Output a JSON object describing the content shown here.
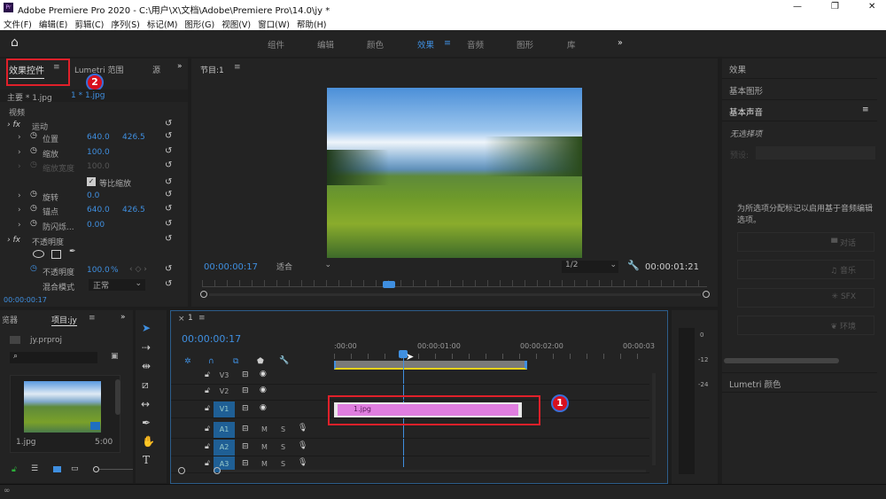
{
  "window": {
    "title": "Adobe Premiere Pro 2020 - C:\\用户\\X\\文档\\Adobe\\Premiere Pro\\14.0\\jy *",
    "app_icon": "Pr",
    "minimize": "—",
    "maximize": "❐",
    "close": "✕"
  },
  "menu": [
    "文件(F)",
    "编辑(E)",
    "剪辑(C)",
    "序列(S)",
    "标记(M)",
    "图形(G)",
    "视图(V)",
    "窗口(W)",
    "帮助(H)"
  ],
  "workspaces": {
    "items": [
      "组件",
      "编辑",
      "颜色",
      "效果",
      "音频",
      "图形",
      "库"
    ],
    "active": "效果",
    "more": "»"
  },
  "effect_controls": {
    "tabs": [
      "效果控件",
      "Lumetri 范围",
      "源"
    ],
    "more": "»",
    "source_label": "主要 * 1.jpg",
    "clip_label": "1 * 1.jpg",
    "section": "视频",
    "motion": "运动",
    "params": [
      {
        "name": "位置",
        "v1": "640.0",
        "v2": "426.5"
      },
      {
        "name": "缩放",
        "v1": "100.0"
      },
      {
        "name": "缩放宽度",
        "v1": "100.0",
        "disabled": true
      },
      {
        "name": "旋转",
        "v1": "0.0"
      },
      {
        "name": "锚点",
        "v1": "640.0",
        "v2": "426.5"
      },
      {
        "name": "防闪烁...",
        "v1": "0.00"
      }
    ],
    "uniform_scale": "等比缩放",
    "uniform_scale_checked": true,
    "opacity": "不透明度",
    "opacity_param": "不透明度",
    "opacity_value": "100.0",
    "opacity_unit": "%",
    "blend_label": "混合模式",
    "blend_value": "正常",
    "timecode": "00:00:00:17"
  },
  "program": {
    "title": "节目:1",
    "timecode": "00:00:00:17",
    "fit": "适合",
    "resolution": "1/2",
    "duration": "00:00:01:21"
  },
  "right_panel": {
    "items": [
      "效果",
      "基本图形",
      "基本声音"
    ],
    "no_selection": "无选择项",
    "preset_label": "预设:",
    "hint": "为所选项分配标记以启用基于音频编辑选项。",
    "buttons": [
      "对话",
      "音乐",
      "SFX",
      "环境"
    ],
    "lumetri": "Lumetri 颜色"
  },
  "project": {
    "tabs": [
      "览器",
      "项目:jy"
    ],
    "more": "»",
    "file": "jy.prproj",
    "clip_name": "1.jpg",
    "clip_duration": "5:00"
  },
  "timeline": {
    "tab": "1",
    "timecode": "00:00:00:17",
    "ruler": [
      ":00:00",
      "00:00:01:00",
      "00:00:02:00",
      "00:00:03"
    ],
    "video_tracks": [
      "V3",
      "V2",
      "V1"
    ],
    "audio_tracks": [
      "A1",
      "A2",
      "A3"
    ],
    "mute": "M",
    "solo": "S",
    "clip": "1.jpg"
  },
  "meter": {
    "labels": [
      "0",
      "-12",
      "-24"
    ]
  },
  "annotations": {
    "one": "1",
    "two": "2"
  },
  "colors": {
    "accent": "#3f8fe0",
    "clip": "#e07ee0",
    "annotation": "#e0202a"
  }
}
